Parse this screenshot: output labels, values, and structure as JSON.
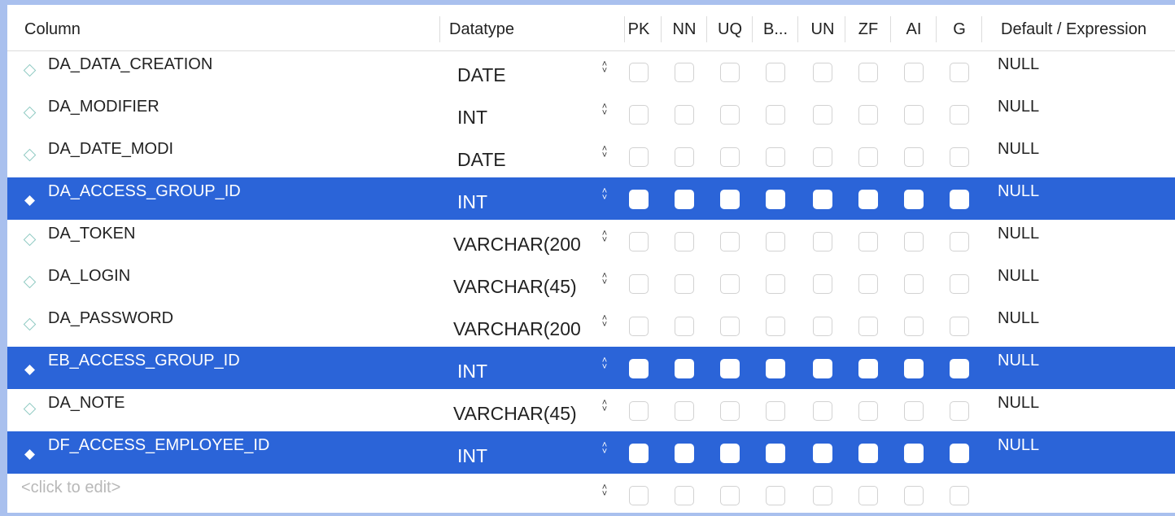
{
  "header": {
    "column": "Column",
    "datatype": "Datatype",
    "flags": [
      "PK",
      "NN",
      "UQ",
      "B...",
      "UN",
      "ZF",
      "AI",
      "G"
    ],
    "default": "Default / Expression"
  },
  "rows": [
    {
      "name": "DA_DATA_CREATION",
      "type": "DATE",
      "default": "NULL",
      "selected": false
    },
    {
      "name": "DA_MODIFIER",
      "type": "INT",
      "default": "NULL",
      "selected": false
    },
    {
      "name": "DA_DATE_MODI",
      "type": "DATE",
      "default": "NULL",
      "selected": false
    },
    {
      "name": "DA_ACCESS_GROUP_ID",
      "type": "INT",
      "default": "NULL",
      "selected": true
    },
    {
      "name": "DA_TOKEN",
      "type": "VARCHAR(200",
      "default": "NULL",
      "selected": false
    },
    {
      "name": "DA_LOGIN",
      "type": "VARCHAR(45)",
      "default": "NULL",
      "selected": false
    },
    {
      "name": "DA_PASSWORD",
      "type": "VARCHAR(200",
      "default": "NULL",
      "selected": false
    },
    {
      "name": "EB_ACCESS_GROUP_ID",
      "type": "INT",
      "default": "NULL",
      "selected": true
    },
    {
      "name": "DA_NOTE",
      "type": "VARCHAR(45)",
      "default": "NULL",
      "selected": false
    },
    {
      "name": "DF_ACCESS_EMPLOYEE_ID",
      "type": "INT",
      "default": "NULL",
      "selected": true
    }
  ],
  "new_row": {
    "placeholder": "<click to edit>"
  },
  "colors": {
    "selection": "#2b64d8",
    "diamond": "#8ec9c2"
  },
  "icons": {
    "column_icon": "diamond-icon",
    "type_stepper": "chevron-up-down-icon"
  }
}
